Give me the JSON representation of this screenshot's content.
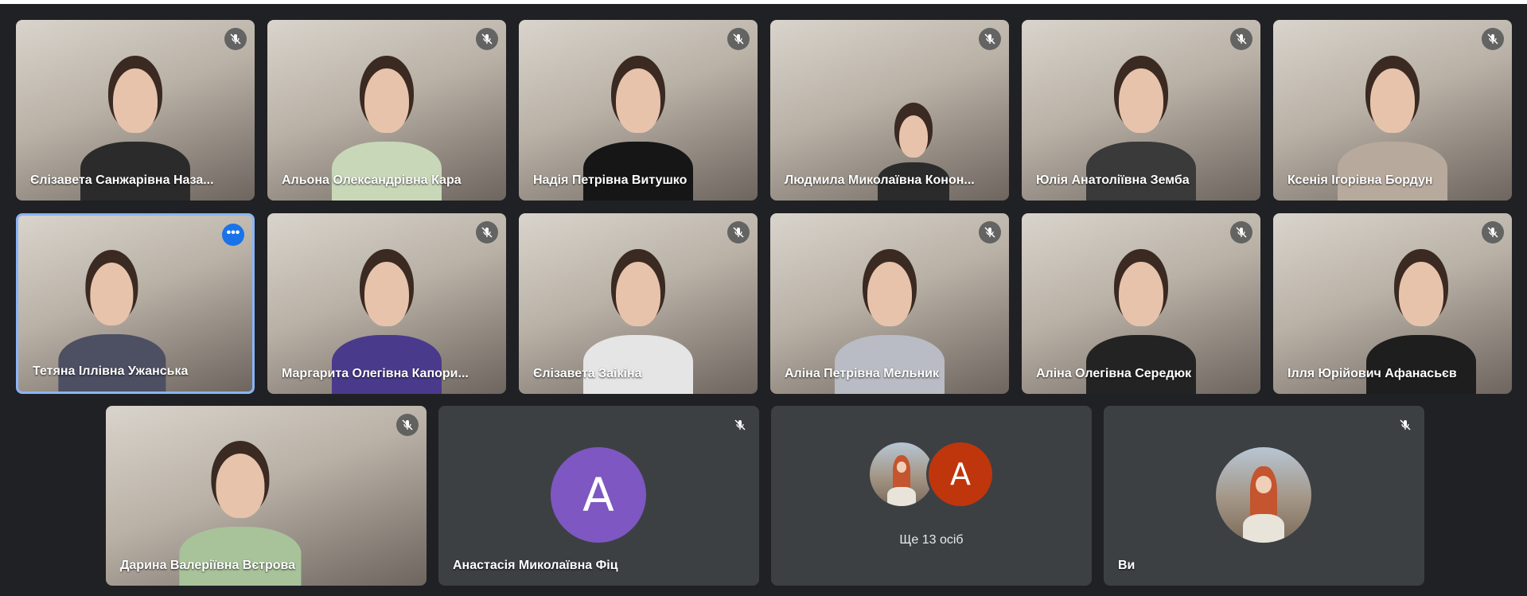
{
  "tiles": [
    {
      "name": "Єлізавета Санжарівна Наза..."
    },
    {
      "name": "Альона Олександрівна Кара"
    },
    {
      "name": "Надія Петрівна Витушко"
    },
    {
      "name": "Людмила Миколаївна Конон..."
    },
    {
      "name": "Юлія Анатоліївна Земба"
    },
    {
      "name": "Ксенія Ігорівна Бордун"
    },
    {
      "name": "Тетяна Іллівна Ужанська"
    },
    {
      "name": "Маргарита Олегівна Капори..."
    },
    {
      "name": "Єлізавета Заікіна"
    },
    {
      "name": "Аліна Петрівна Мельник"
    },
    {
      "name": "Аліна Олегівна Середюк"
    },
    {
      "name": "Ілля Юрійович Афанасьєв"
    },
    {
      "name": "Дарина Валеріївна Вєтрова"
    },
    {
      "name": "Анастасія Миколаївна Фіц",
      "avatar_letter": "A",
      "avatar_color": "#7e57c2"
    },
    {
      "more_label": "Ще 13 осіб",
      "avatar_letter": "A",
      "avatar_color": "#bf360c"
    },
    {
      "name": "Ви"
    }
  ],
  "more_options_glyph": "•••",
  "colors": {
    "background": "#202124",
    "tile_dark": "#3c4043",
    "active_border": "#8ab4f8"
  }
}
